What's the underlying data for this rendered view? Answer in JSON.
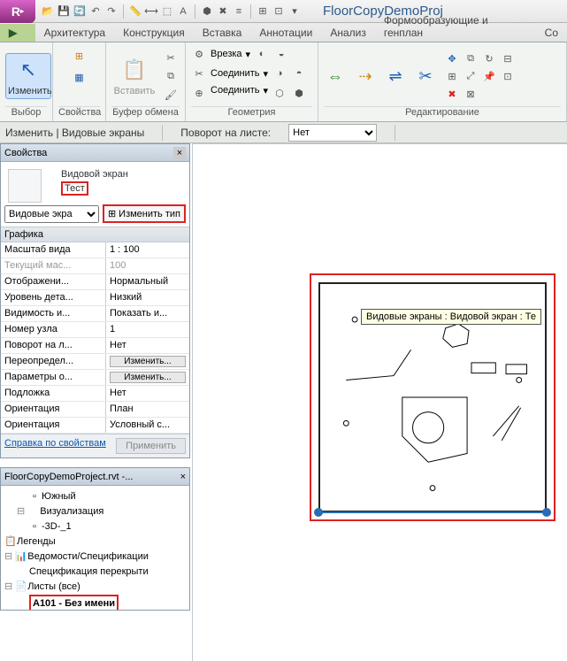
{
  "app_title": "FloorCopyDemoProj",
  "ribbon_tabs": [
    "Архитектура",
    "Конструкция",
    "Вставка",
    "Аннотации",
    "Анализ",
    "Формообразующие и генплан",
    "Со"
  ],
  "panels": {
    "modify_btn": "Изменить",
    "select_lbl": "Выбор",
    "properties_lbl": "Свойства",
    "paste_btn": "Вставить",
    "clipboard_lbl": "Буфер обмена",
    "cut_btn": "Врезка",
    "join_btn": "Соединить",
    "geometry_lbl": "Геометрия",
    "edit_lbl": "Редактирование"
  },
  "options_bar": {
    "context": "Изменить | Видовые экраны",
    "rotation_lbl": "Поворот на листе:",
    "rotation_val": "Нет"
  },
  "properties": {
    "title": "Свойства",
    "family": "Видовой экран",
    "type": "Тест",
    "filter_sel": "Видовые экра",
    "edit_type_btn": "Изменить тип",
    "cat_graphics": "Графика",
    "rows": [
      {
        "k": "Масштаб вида",
        "v": "1 : 100",
        "cls": ""
      },
      {
        "k": "Текущий мас...",
        "v": "100",
        "cls": "dis"
      },
      {
        "k": "Отображени...",
        "v": "Нормальный",
        "cls": ""
      },
      {
        "k": "Уровень дета...",
        "v": "Низкий",
        "cls": ""
      },
      {
        "k": "Видимость и...",
        "v": "Показать и...",
        "cls": ""
      },
      {
        "k": "Номер узла",
        "v": "1",
        "cls": ""
      },
      {
        "k": "Поворот на л...",
        "v": "Нет",
        "cls": ""
      },
      {
        "k": "Переопредел...",
        "v": "btn:Изменить...",
        "cls": ""
      },
      {
        "k": "Параметры о...",
        "v": "btn:Изменить...",
        "cls": ""
      },
      {
        "k": "Подложка",
        "v": "Нет",
        "cls": ""
      },
      {
        "k": "Ориентация",
        "v": "План",
        "cls": ""
      },
      {
        "k": "Ориентация",
        "v": "Условный с...",
        "cls": ""
      }
    ],
    "help_link": "Справка по свойствам",
    "apply_btn": "Применить"
  },
  "browser": {
    "title": "FloorCopyDemoProject.rvt -...",
    "nodes": [
      {
        "lvl": 2,
        "txt": "Южный",
        "leaf": true,
        "ic": "▫"
      },
      {
        "lvl": 1,
        "txt": "Визуализация",
        "leaf": false,
        "ic": ""
      },
      {
        "lvl": 2,
        "txt": "-3D-_1",
        "leaf": true,
        "ic": "▫"
      },
      {
        "lvl": 0,
        "txt": "Легенды",
        "leaf": true,
        "ic": "📋"
      },
      {
        "lvl": 0,
        "txt": "Ведомости/Спецификации",
        "leaf": false,
        "ic": "📊"
      },
      {
        "lvl": 1,
        "txt": "Спецификация перекрыти",
        "leaf": true,
        "ic": ""
      },
      {
        "lvl": 0,
        "txt": "Листы (все)",
        "leaf": false,
        "ic": "📄"
      },
      {
        "lvl": 1,
        "txt": "A101 - Без имени",
        "leaf": true,
        "ic": "",
        "hl": true
      }
    ]
  },
  "tooltip": "Видовые экраны : Видовой экран : Те"
}
